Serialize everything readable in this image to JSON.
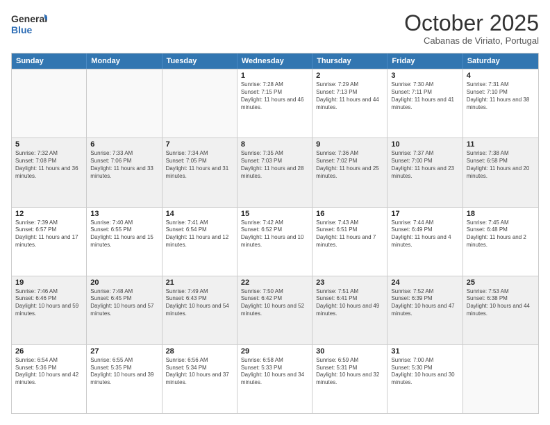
{
  "header": {
    "logo_general": "General",
    "logo_blue": "Blue",
    "month_title": "October 2025",
    "location": "Cabanas de Viriato, Portugal"
  },
  "calendar": {
    "days": [
      "Sunday",
      "Monday",
      "Tuesday",
      "Wednesday",
      "Thursday",
      "Friday",
      "Saturday"
    ],
    "rows": [
      [
        {
          "day": "",
          "text": "",
          "empty": true
        },
        {
          "day": "",
          "text": "",
          "empty": true
        },
        {
          "day": "",
          "text": "",
          "empty": true
        },
        {
          "day": "1",
          "text": "Sunrise: 7:28 AM\nSunset: 7:15 PM\nDaylight: 11 hours and 46 minutes."
        },
        {
          "day": "2",
          "text": "Sunrise: 7:29 AM\nSunset: 7:13 PM\nDaylight: 11 hours and 44 minutes."
        },
        {
          "day": "3",
          "text": "Sunrise: 7:30 AM\nSunset: 7:11 PM\nDaylight: 11 hours and 41 minutes."
        },
        {
          "day": "4",
          "text": "Sunrise: 7:31 AM\nSunset: 7:10 PM\nDaylight: 11 hours and 38 minutes."
        }
      ],
      [
        {
          "day": "5",
          "text": "Sunrise: 7:32 AM\nSunset: 7:08 PM\nDaylight: 11 hours and 36 minutes."
        },
        {
          "day": "6",
          "text": "Sunrise: 7:33 AM\nSunset: 7:06 PM\nDaylight: 11 hours and 33 minutes."
        },
        {
          "day": "7",
          "text": "Sunrise: 7:34 AM\nSunset: 7:05 PM\nDaylight: 11 hours and 31 minutes."
        },
        {
          "day": "8",
          "text": "Sunrise: 7:35 AM\nSunset: 7:03 PM\nDaylight: 11 hours and 28 minutes."
        },
        {
          "day": "9",
          "text": "Sunrise: 7:36 AM\nSunset: 7:02 PM\nDaylight: 11 hours and 25 minutes."
        },
        {
          "day": "10",
          "text": "Sunrise: 7:37 AM\nSunset: 7:00 PM\nDaylight: 11 hours and 23 minutes."
        },
        {
          "day": "11",
          "text": "Sunrise: 7:38 AM\nSunset: 6:58 PM\nDaylight: 11 hours and 20 minutes."
        }
      ],
      [
        {
          "day": "12",
          "text": "Sunrise: 7:39 AM\nSunset: 6:57 PM\nDaylight: 11 hours and 17 minutes."
        },
        {
          "day": "13",
          "text": "Sunrise: 7:40 AM\nSunset: 6:55 PM\nDaylight: 11 hours and 15 minutes."
        },
        {
          "day": "14",
          "text": "Sunrise: 7:41 AM\nSunset: 6:54 PM\nDaylight: 11 hours and 12 minutes."
        },
        {
          "day": "15",
          "text": "Sunrise: 7:42 AM\nSunset: 6:52 PM\nDaylight: 11 hours and 10 minutes."
        },
        {
          "day": "16",
          "text": "Sunrise: 7:43 AM\nSunset: 6:51 PM\nDaylight: 11 hours and 7 minutes."
        },
        {
          "day": "17",
          "text": "Sunrise: 7:44 AM\nSunset: 6:49 PM\nDaylight: 11 hours and 4 minutes."
        },
        {
          "day": "18",
          "text": "Sunrise: 7:45 AM\nSunset: 6:48 PM\nDaylight: 11 hours and 2 minutes."
        }
      ],
      [
        {
          "day": "19",
          "text": "Sunrise: 7:46 AM\nSunset: 6:46 PM\nDaylight: 10 hours and 59 minutes."
        },
        {
          "day": "20",
          "text": "Sunrise: 7:48 AM\nSunset: 6:45 PM\nDaylight: 10 hours and 57 minutes."
        },
        {
          "day": "21",
          "text": "Sunrise: 7:49 AM\nSunset: 6:43 PM\nDaylight: 10 hours and 54 minutes."
        },
        {
          "day": "22",
          "text": "Sunrise: 7:50 AM\nSunset: 6:42 PM\nDaylight: 10 hours and 52 minutes."
        },
        {
          "day": "23",
          "text": "Sunrise: 7:51 AM\nSunset: 6:41 PM\nDaylight: 10 hours and 49 minutes."
        },
        {
          "day": "24",
          "text": "Sunrise: 7:52 AM\nSunset: 6:39 PM\nDaylight: 10 hours and 47 minutes."
        },
        {
          "day": "25",
          "text": "Sunrise: 7:53 AM\nSunset: 6:38 PM\nDaylight: 10 hours and 44 minutes."
        }
      ],
      [
        {
          "day": "26",
          "text": "Sunrise: 6:54 AM\nSunset: 5:36 PM\nDaylight: 10 hours and 42 minutes."
        },
        {
          "day": "27",
          "text": "Sunrise: 6:55 AM\nSunset: 5:35 PM\nDaylight: 10 hours and 39 minutes."
        },
        {
          "day": "28",
          "text": "Sunrise: 6:56 AM\nSunset: 5:34 PM\nDaylight: 10 hours and 37 minutes."
        },
        {
          "day": "29",
          "text": "Sunrise: 6:58 AM\nSunset: 5:33 PM\nDaylight: 10 hours and 34 minutes."
        },
        {
          "day": "30",
          "text": "Sunrise: 6:59 AM\nSunset: 5:31 PM\nDaylight: 10 hours and 32 minutes."
        },
        {
          "day": "31",
          "text": "Sunrise: 7:00 AM\nSunset: 5:30 PM\nDaylight: 10 hours and 30 minutes."
        },
        {
          "day": "",
          "text": "",
          "empty": true
        }
      ]
    ]
  }
}
